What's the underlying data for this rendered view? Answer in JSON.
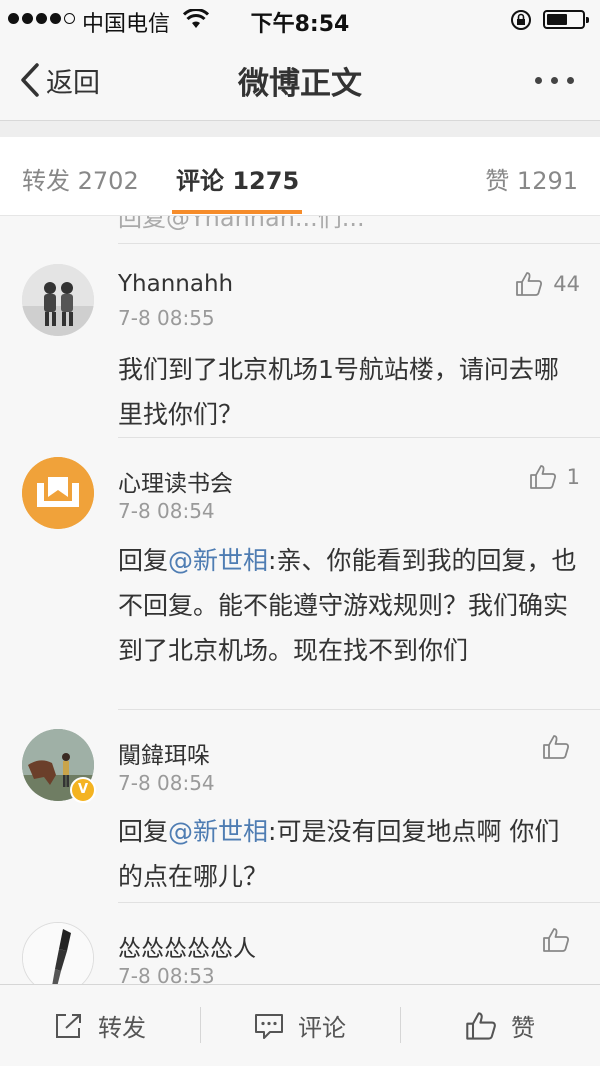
{
  "status_bar": {
    "carrier": "中国电信",
    "time": "下午8:54"
  },
  "nav": {
    "back_label": "返回",
    "title": "微博正文"
  },
  "tabs": [
    {
      "label": "转发",
      "count": "2702"
    },
    {
      "label": "评论",
      "count": "1275"
    },
    {
      "label": "赞",
      "count": "1291"
    }
  ],
  "partial_text": "回复@Yhannah...们...",
  "comments": [
    {
      "author": "Yhannahh",
      "time": "7-8 08:55",
      "likes": "44",
      "text": "我们到了北京机场1号航站楼，请问去哪里找你们？"
    },
    {
      "author": "心理读书会",
      "time": "7-8 08:54",
      "likes": "1",
      "reply_prefix": "回复",
      "mention": "@新世相",
      "text": ":亲、你能看到我的回复，也不回复。能不能遵守游戏规则？我们确实到了北京机场。现在找不到你们"
    },
    {
      "author": "闃鍏珥哚",
      "time": "7-8 08:54",
      "likes": "",
      "reply_prefix": "回复",
      "mention": "@新世相",
      "text": ":可是没有回复地点啊 你们的点在哪儿？"
    },
    {
      "author": "怂怂怂怂怂人",
      "time": "7-8 08:53",
      "likes": ""
    }
  ],
  "verified_badge": "V",
  "bottom_bar": {
    "repost": "转发",
    "comment": "评论",
    "like": "赞"
  },
  "colors": {
    "accent": "#f68c2a",
    "mention": "#4f7db3",
    "verified": "#f4b321"
  }
}
